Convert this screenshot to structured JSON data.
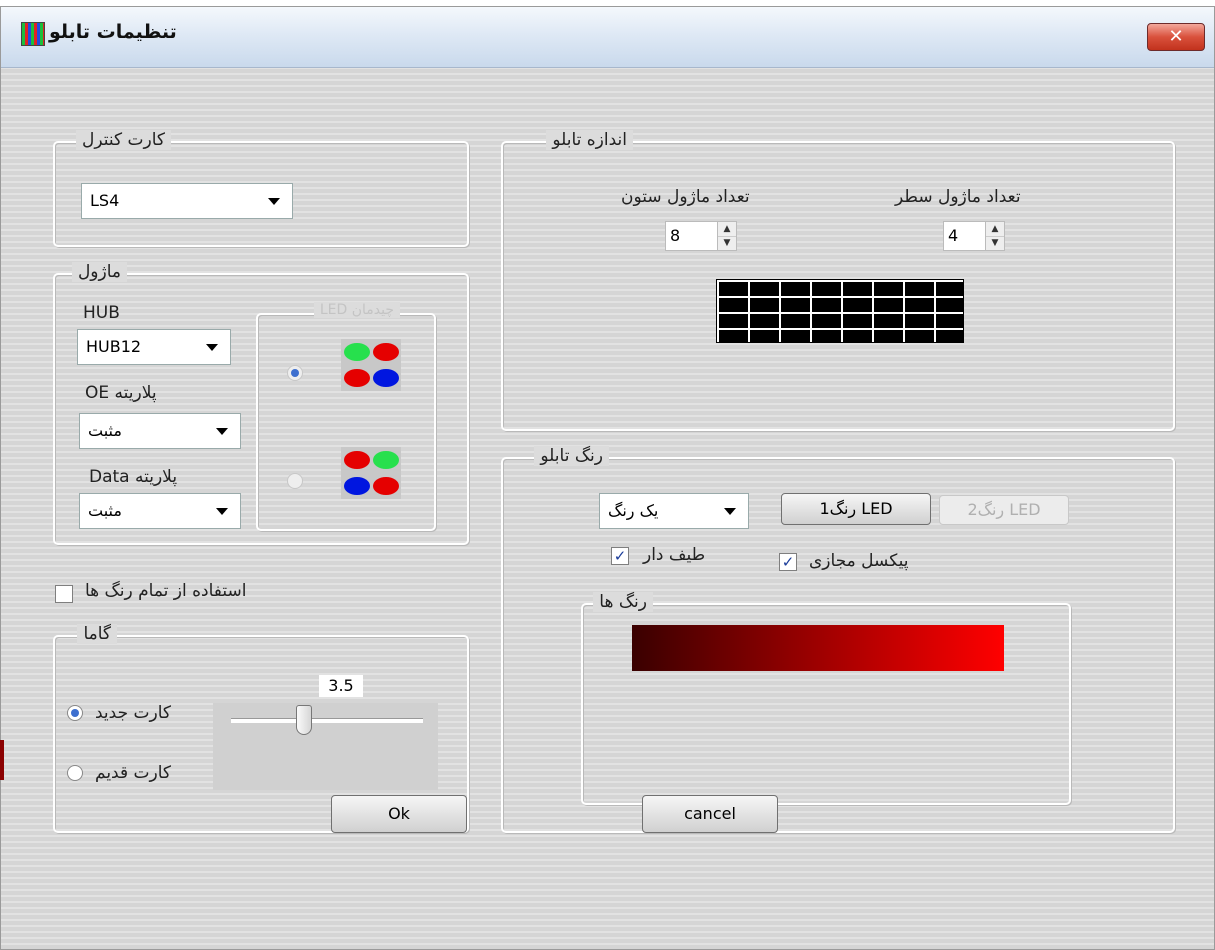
{
  "window": {
    "title": "تنظیمات تابلو",
    "close_label": "✕"
  },
  "control_card": {
    "legend": "کارت کنترل",
    "selected": "LS4"
  },
  "module": {
    "legend": "ماژول",
    "hub_label": "HUB",
    "hub_value": "HUB12",
    "oe_label": "پلاریته OE",
    "oe_value": "مثبت",
    "data_label": "پلاریته Data",
    "data_value": "مثبت",
    "led_legend": "چیدمان LED",
    "led_layouts": [
      {
        "checked": true,
        "colors": [
          "#27e04d",
          "#e50000",
          "#e50000",
          "#0016e0"
        ]
      },
      {
        "checked": false,
        "colors": [
          "#e50000",
          "#27e04d",
          "#0016e0",
          "#e50000"
        ]
      }
    ]
  },
  "all_colors": {
    "label": "استفاده از تمام رنگ ها",
    "checked": false
  },
  "gamma": {
    "legend": "گاما",
    "value": "3.5",
    "slider_fraction": 0.38,
    "new_card": "کارت جدید",
    "old_card": "کارت قدیم",
    "selected": "new"
  },
  "board_size": {
    "legend": "اندازه تابلو",
    "col_label": "تعداد ماژول ستون",
    "col_value": "8",
    "row_label": "تعداد ماژول سطر",
    "row_value": "4"
  },
  "board_color": {
    "legend": "رنگ تابلو",
    "color_mode": "یک رنگ",
    "led1_label": "رنگ1 LED",
    "led2_label": "رنگ2 LED",
    "spectrum_label": "طیف دار",
    "spectrum_checked": true,
    "virtual_pixel_label": "پیکسل مجازی",
    "virtual_pixel_checked": true,
    "colors_legend": "رنگ ها",
    "gradient_colors": [
      "#3a0000",
      "#ff0000"
    ]
  },
  "buttons": {
    "ok": "Ok",
    "cancel": "cancel"
  }
}
